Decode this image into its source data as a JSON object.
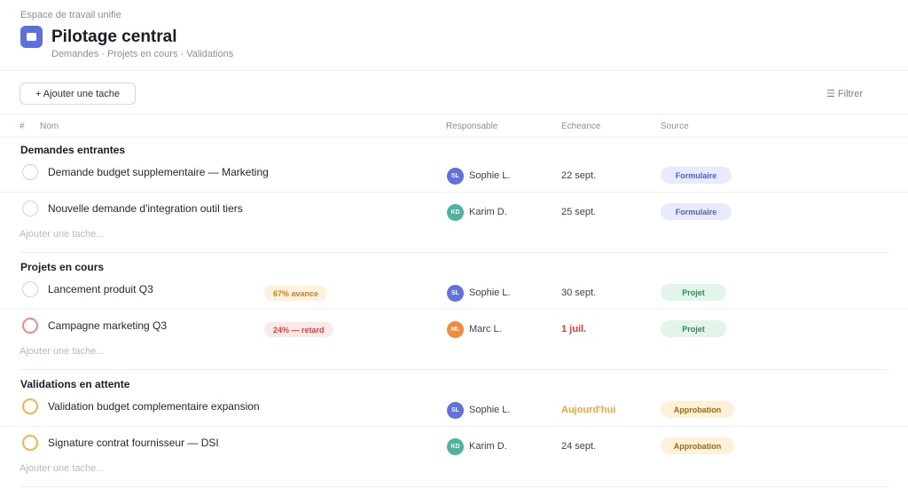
{
  "header": {
    "workspace": "Espace de travail unifie",
    "title": "Pilotage central",
    "breadcrumb": "Demandes · Projets en cours · Validations"
  },
  "toolbar": {
    "add_label": "+ Ajouter une tache",
    "filter_label": "☰ Filtrer"
  },
  "columns": {
    "hash": "#",
    "name": "Nom",
    "assignee": "Responsable",
    "due": "Echeance",
    "source": "Source"
  },
  "add_task_label": "Ajouter une tache...",
  "sections": [
    {
      "title": "Demandes entrantes",
      "tasks": [
        {
          "name": "Demande budget supplementaire — Marketing",
          "initials": "SL",
          "assignee": "Sophie L.",
          "due": "22 sept.",
          "source": "Formulaire"
        },
        {
          "name": "Nouvelle demande d'integration outil tiers",
          "initials": "KD",
          "assignee": "Karim D.",
          "due": "25 sept.",
          "source": "Formulaire"
        }
      ]
    },
    {
      "title": "Projets en cours",
      "tasks": [
        {
          "name": "Lancement produit Q3",
          "progress": "67% avance",
          "initials": "SL",
          "assignee": "Sophie L.",
          "due": "30 sept.",
          "source": "Projet"
        },
        {
          "name": "Campagne marketing Q3",
          "progress": "24% — retard",
          "initials": "ML",
          "assignee": "Marc L.",
          "due": "1 juil.",
          "source": "Projet"
        }
      ]
    },
    {
      "title": "Validations en attente",
      "tasks": [
        {
          "name": "Validation budget complementaire expansion",
          "initials": "SL",
          "assignee": "Sophie L.",
          "due": "Aujourd'hui",
          "source": "Approbation"
        },
        {
          "name": "Signature contrat fournisseur — DSI",
          "initials": "KD",
          "assignee": "Karim D.",
          "due": "24 sept.",
          "source": "Approbation"
        }
      ]
    }
  ],
  "colors": {
    "accent": "#5b6fe0",
    "overdue": "#e03a3a",
    "today": "#f2a33a"
  }
}
